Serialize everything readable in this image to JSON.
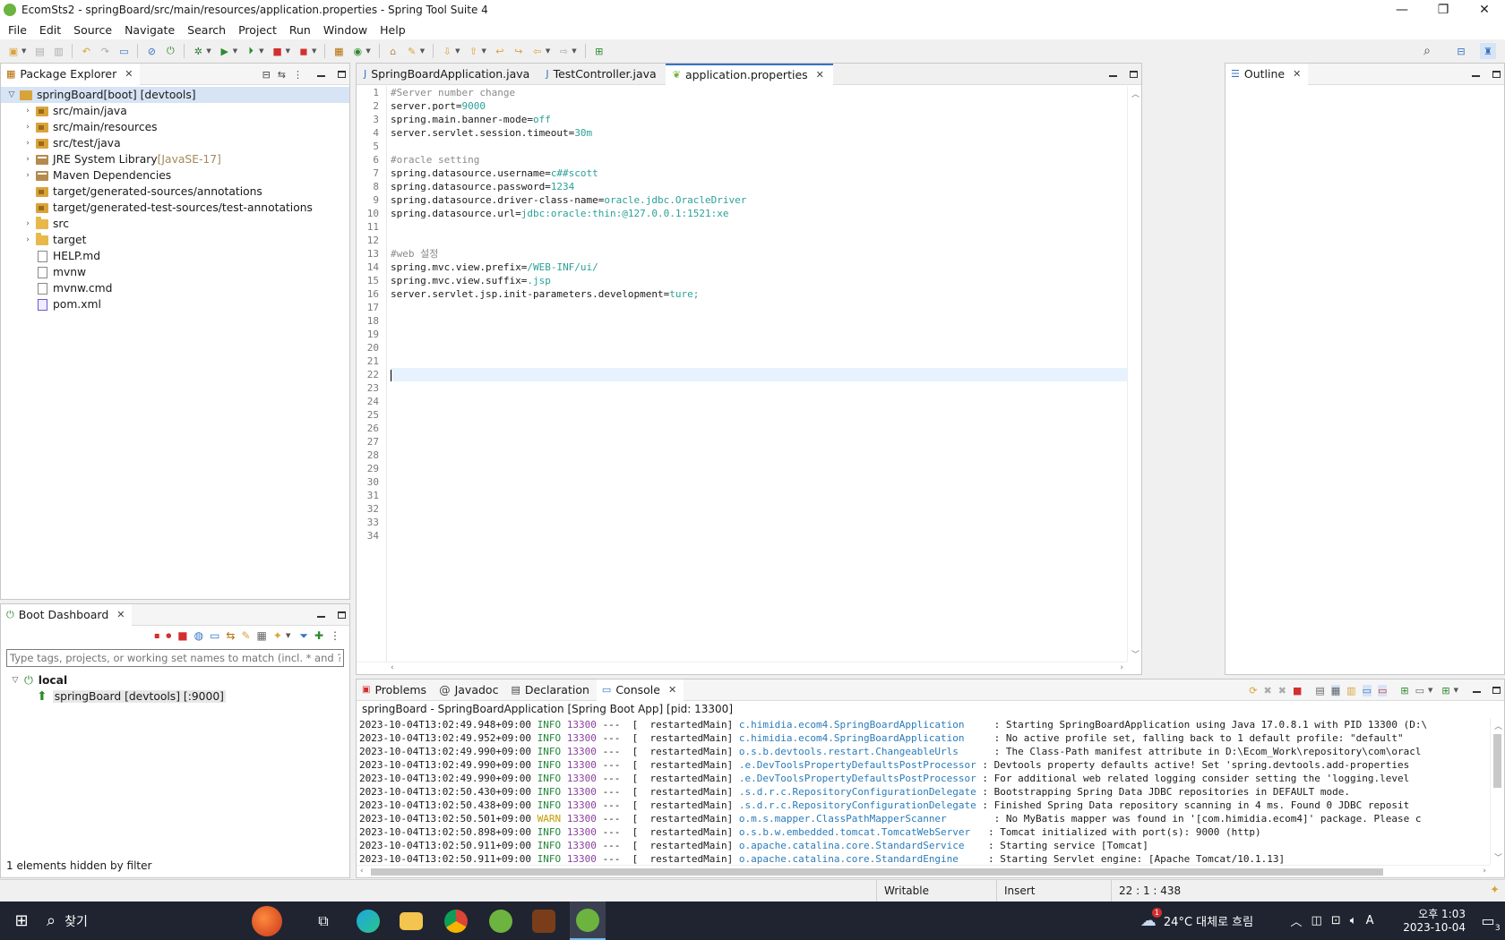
{
  "window": {
    "title": "EcomSts2 - springBoard/src/main/resources/application.properties - Spring Tool Suite 4",
    "controls": {
      "minimize": "—",
      "restore": "❐",
      "close": "✕"
    }
  },
  "menu": [
    "File",
    "Edit",
    "Source",
    "Navigate",
    "Search",
    "Project",
    "Run",
    "Window",
    "Help"
  ],
  "package_explorer": {
    "title": "Package Explorer",
    "items": [
      {
        "label": "springBoard",
        "tag": " [boot] [devtools]",
        "indent": 0,
        "twisty": "▽",
        "icon": "project",
        "selected": true
      },
      {
        "label": "src/main/java",
        "tag": "",
        "indent": 1,
        "twisty": "›",
        "icon": "pkgfolder"
      },
      {
        "label": "src/main/resources",
        "tag": "",
        "indent": 1,
        "twisty": "›",
        "icon": "pkgfolder"
      },
      {
        "label": "src/test/java",
        "tag": "",
        "indent": 1,
        "twisty": "›",
        "icon": "pkgfolder"
      },
      {
        "label": "JRE System Library ",
        "tag": "[JavaSE-17]",
        "indent": 1,
        "twisty": "›",
        "icon": "lib"
      },
      {
        "label": "Maven Dependencies",
        "tag": "",
        "indent": 1,
        "twisty": "›",
        "icon": "lib"
      },
      {
        "label": "target/generated-sources/annotations",
        "tag": "",
        "indent": 1,
        "twisty": "",
        "icon": "pkgfolder"
      },
      {
        "label": "target/generated-test-sources/test-annotations",
        "tag": "",
        "indent": 1,
        "twisty": "",
        "icon": "pkgfolder"
      },
      {
        "label": "src",
        "tag": "",
        "indent": 1,
        "twisty": "›",
        "icon": "folder"
      },
      {
        "label": "target",
        "tag": "",
        "indent": 1,
        "twisty": "›",
        "icon": "folder"
      },
      {
        "label": "HELP.md",
        "tag": "",
        "indent": 1,
        "twisty": "",
        "icon": "file"
      },
      {
        "label": "mvnw",
        "tag": "",
        "indent": 1,
        "twisty": "",
        "icon": "file"
      },
      {
        "label": "mvnw.cmd",
        "tag": "",
        "indent": 1,
        "twisty": "",
        "icon": "file"
      },
      {
        "label": "pom.xml",
        "tag": "",
        "indent": 1,
        "twisty": "",
        "icon": "xml"
      }
    ]
  },
  "editor": {
    "tabs": [
      {
        "label": "SpringBoardApplication.java",
        "active": false,
        "icon": "java-file-icon"
      },
      {
        "label": "TestController.java",
        "active": false,
        "icon": "java-file-icon"
      },
      {
        "label": "application.properties",
        "active": true,
        "icon": "properties-leaf-icon"
      }
    ],
    "line_count": 34,
    "cursor_line": 22,
    "lines": [
      {
        "n": 1,
        "key": "",
        "val": "",
        "comment": "#Server number change"
      },
      {
        "n": 2,
        "key": "server.port=",
        "val": "9000",
        "comment": ""
      },
      {
        "n": 3,
        "key": "spring.main.banner-mode=",
        "val": "off",
        "comment": ""
      },
      {
        "n": 4,
        "key": "server.servlet.session.timeout=",
        "val": "30m",
        "comment": ""
      },
      {
        "n": 6,
        "key": "",
        "val": "",
        "comment": "#oracle setting"
      },
      {
        "n": 7,
        "key": "spring.datasource.username=",
        "val": "c##scott",
        "comment": ""
      },
      {
        "n": 8,
        "key": "spring.datasource.password=",
        "val": "1234",
        "comment": ""
      },
      {
        "n": 9,
        "key": "spring.datasource.driver-class-name=",
        "val": "oracle.jdbc.OracleDriver",
        "comment": ""
      },
      {
        "n": 10,
        "key": "spring.datasource.url=",
        "val": "jdbc:oracle:thin:@127.0.0.1:1521:xe",
        "comment": ""
      },
      {
        "n": 13,
        "key": "",
        "val": "",
        "comment": "#web 설정"
      },
      {
        "n": 14,
        "key": "spring.mvc.view.prefix=",
        "val": "/WEB-INF/ui/",
        "comment": ""
      },
      {
        "n": 15,
        "key": "spring.mvc.view.suffix=",
        "val": ".jsp",
        "comment": ""
      },
      {
        "n": 16,
        "key": "server.servlet.jsp.init-parameters.development=",
        "val": "ture;",
        "comment": ""
      }
    ]
  },
  "outline": {
    "title": "Outline"
  },
  "boot_dashboard": {
    "title": "Boot Dashboard",
    "filter_placeholder": "Type tags, projects, or working set names to match (incl. * and ? wildcards)",
    "group": "local",
    "app": "springBoard [devtools] [:9000]",
    "footer": "1 elements hidden by filter"
  },
  "console": {
    "tabs": [
      {
        "label": "Problems",
        "icon": "problems-icon"
      },
      {
        "label": "Javadoc",
        "icon": "at-icon"
      },
      {
        "label": "Declaration",
        "icon": "declaration-icon"
      },
      {
        "label": "Console",
        "icon": "console-icon",
        "active": true
      }
    ],
    "title": "springBoard - SpringBoardApplication [Spring Boot App]  [pid: 13300]",
    "rows": [
      {
        "ts": "2023-10-04T13:02:49.948+09:00",
        "level": "INFO",
        "pid": "13300",
        "thread": "---  [  restartedMain]",
        "logger": "c.himidia.ecom4.SpringBoardApplication    ",
        "msg": " : Starting SpringBoardApplication using Java 17.0.8.1 with PID 13300 (D:\\"
      },
      {
        "ts": "2023-10-04T13:02:49.952+09:00",
        "level": "INFO",
        "pid": "13300",
        "thread": "---  [  restartedMain]",
        "logger": "c.himidia.ecom4.SpringBoardApplication    ",
        "msg": " : No active profile set, falling back to 1 default profile: \"default\""
      },
      {
        "ts": "2023-10-04T13:02:49.990+09:00",
        "level": "INFO",
        "pid": "13300",
        "thread": "---  [  restartedMain]",
        "logger": "o.s.b.devtools.restart.ChangeableUrls     ",
        "msg": " : The Class-Path manifest attribute in D:\\Ecom_Work\\repository\\com\\oracl"
      },
      {
        "ts": "2023-10-04T13:02:49.990+09:00",
        "level": "INFO",
        "pid": "13300",
        "thread": "---  [  restartedMain]",
        "logger": ".e.DevToolsPropertyDefaultsPostProcessor",
        "msg": " : Devtools property defaults active! Set 'spring.devtools.add-properties"
      },
      {
        "ts": "2023-10-04T13:02:49.990+09:00",
        "level": "INFO",
        "pid": "13300",
        "thread": "---  [  restartedMain]",
        "logger": ".e.DevToolsPropertyDefaultsPostProcessor",
        "msg": " : For additional web related logging consider setting the 'logging.level"
      },
      {
        "ts": "2023-10-04T13:02:50.430+09:00",
        "level": "INFO",
        "pid": "13300",
        "thread": "---  [  restartedMain]",
        "logger": ".s.d.r.c.RepositoryConfigurationDelegate",
        "msg": " : Bootstrapping Spring Data JDBC repositories in DEFAULT mode."
      },
      {
        "ts": "2023-10-04T13:02:50.438+09:00",
        "level": "INFO",
        "pid": "13300",
        "thread": "---  [  restartedMain]",
        "logger": ".s.d.r.c.RepositoryConfigurationDelegate",
        "msg": " : Finished Spring Data repository scanning in 4 ms. Found 0 JDBC reposit"
      },
      {
        "ts": "2023-10-04T13:02:50.501+09:00",
        "level": "WARN",
        "pid": "13300",
        "thread": "---  [  restartedMain]",
        "logger": "o.m.s.mapper.ClassPathMapperScanner       ",
        "msg": " : No MyBatis mapper was found in '[com.himidia.ecom4]' package. Please c"
      },
      {
        "ts": "2023-10-04T13:02:50.898+09:00",
        "level": "INFO",
        "pid": "13300",
        "thread": "---  [  restartedMain]",
        "logger": "o.s.b.w.embedded.tomcat.TomcatWebServer  ",
        "msg": " : Tomcat initialized with port(s): 9000 (http)"
      },
      {
        "ts": "2023-10-04T13:02:50.911+09:00",
        "level": "INFO",
        "pid": "13300",
        "thread": "---  [  restartedMain]",
        "logger": "o.apache.catalina.core.StandardService   ",
        "msg": " : Starting service [Tomcat]"
      },
      {
        "ts": "2023-10-04T13:02:50.911+09:00",
        "level": "INFO",
        "pid": "13300",
        "thread": "---  [  restartedMain]",
        "logger": "o.apache.catalina.core.StandardEngine    ",
        "msg": " : Starting Servlet engine: [Apache Tomcat/10.1.13]"
      }
    ]
  },
  "statusbar": {
    "mode": "Writable",
    "insert": "Insert",
    "position": "22 : 1 : 438"
  },
  "taskbar": {
    "search": "찾기",
    "weather": "24°C 대체로 흐림",
    "ime": "A",
    "time": "오후 1:03",
    "date": "2023-10-04",
    "badge": "1",
    "notifications": "3"
  },
  "colors": {
    "accent": "#3573c4",
    "spring_green": "#6db33f",
    "value_teal": "#2aa198"
  }
}
